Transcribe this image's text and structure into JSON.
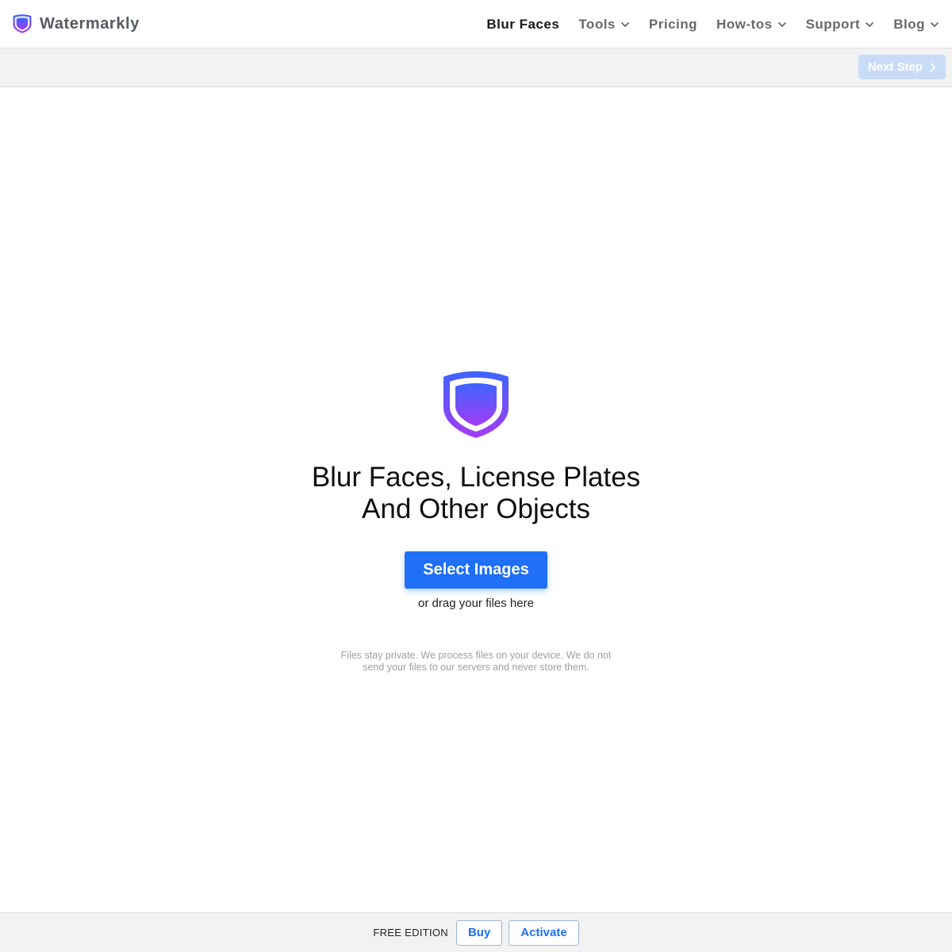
{
  "brand": {
    "name": "Watermarkly",
    "logo_icon": "shield-icon",
    "colors": {
      "gradient_top": "#3d64ff",
      "gradient_bottom": "#a43cf3"
    }
  },
  "nav": {
    "items": [
      {
        "label": "Blur Faces",
        "active": true,
        "dropdown": false
      },
      {
        "label": "Tools",
        "active": false,
        "dropdown": true
      },
      {
        "label": "Pricing",
        "active": false,
        "dropdown": false
      },
      {
        "label": "How-tos",
        "active": false,
        "dropdown": true
      },
      {
        "label": "Support",
        "active": false,
        "dropdown": true
      },
      {
        "label": "Blog",
        "active": false,
        "dropdown": true
      }
    ]
  },
  "toolbar": {
    "next_label": "Next Step",
    "next_icon": "chevron-right-icon"
  },
  "hero": {
    "title": "Blur Faces, License Plates And Other Objects",
    "select_label": "Select Images",
    "drag_hint": "or drag your files here",
    "privacy": "Files stay private. We process files on your device. We do not send your files to our servers and never store them."
  },
  "footer": {
    "edition": "FREE EDITION",
    "buy_label": "Buy",
    "activate_label": "Activate"
  },
  "colors": {
    "accent": "#1f6ff7",
    "disabled_button": "#c9dcf7"
  }
}
